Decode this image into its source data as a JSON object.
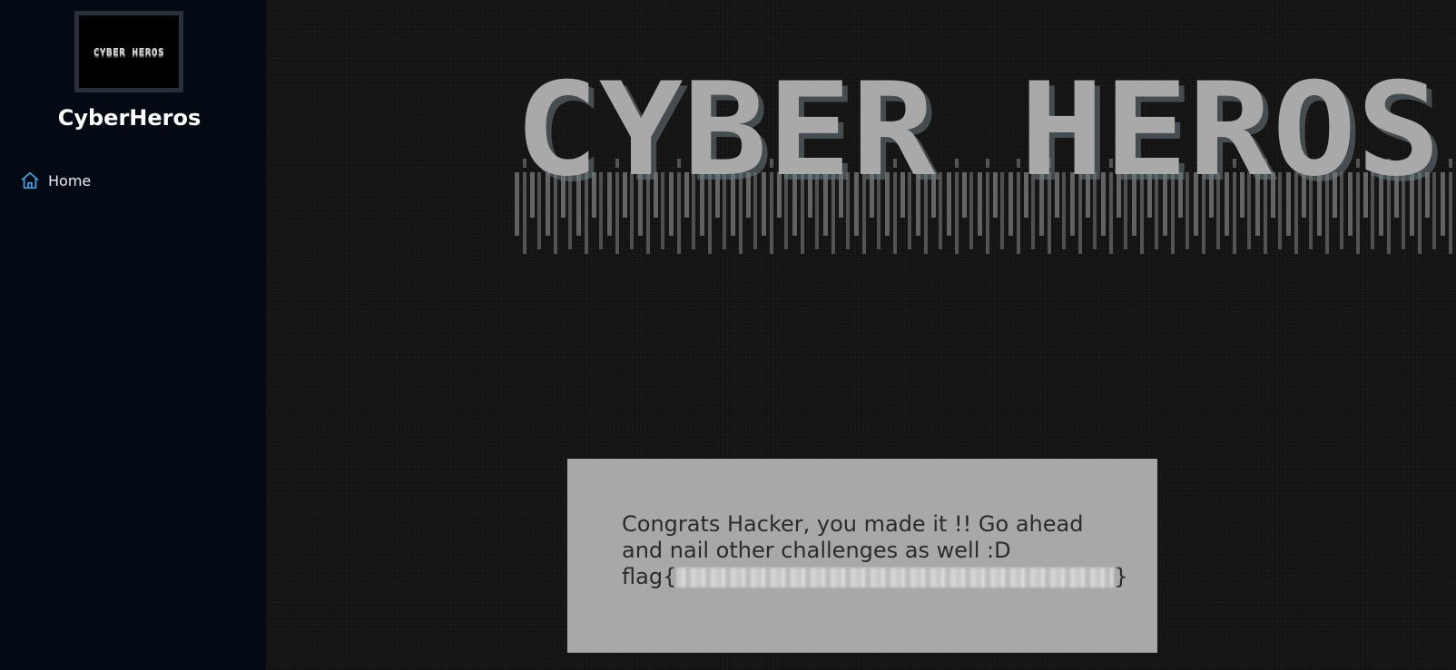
{
  "sidebar": {
    "logo_text": "CYBER HEROS",
    "app_name": "CyberHeros",
    "nav": [
      {
        "label": "Home",
        "icon": "home-icon"
      }
    ]
  },
  "hero": {
    "title": "CYBER HEROS"
  },
  "message": {
    "text": "Congrats Hacker, you made it !! Go ahead and nail other challenges as well :D",
    "flag_prefix": "flag{",
    "flag_suffix": "}"
  },
  "colors": {
    "sidebar_bg": "#040a14",
    "main_bg": "#121212",
    "panel_bg": "#a8a8a8",
    "accent": "#3b9ee0"
  }
}
